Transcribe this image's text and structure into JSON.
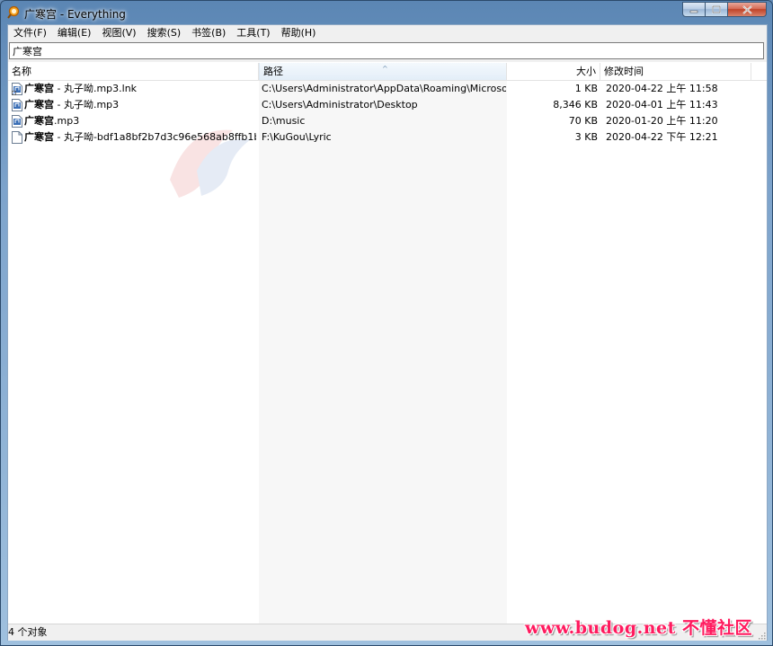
{
  "window": {
    "title": "广寒宫 - Everything",
    "minimize_glyph": "─",
    "maximize_glyph": "□",
    "close_glyph": "✕"
  },
  "menu": [
    "文件(F)",
    "编辑(E)",
    "视图(V)",
    "搜索(S)",
    "书签(B)",
    "工具(T)",
    "帮助(H)"
  ],
  "search": {
    "value": "广寒宫"
  },
  "columns": {
    "name": "名称",
    "path": "路径",
    "size": "大小",
    "modified": "修改时间",
    "sort_arrow": "^"
  },
  "rows": [
    {
      "name_bold": "广寒宫",
      "name_rest": " - 丸子呦.mp3.lnk",
      "path": "C:\\Users\\Administrator\\AppData\\Roaming\\Microsof...",
      "size": "1 KB",
      "modified": "2020-04-22 上午 11:58",
      "icon": "audio-shortcut-icon"
    },
    {
      "name_bold": "广寒宫",
      "name_rest": " - 丸子呦.mp3",
      "path": "C:\\Users\\Administrator\\Desktop",
      "size": "8,346 KB",
      "modified": "2020-04-01 上午 11:43",
      "icon": "audio-file-icon"
    },
    {
      "name_bold": "广寒宫",
      "name_rest": ".mp3",
      "path": "D:\\music",
      "size": "70 KB",
      "modified": "2020-01-20 上午 11:20",
      "icon": "audio-file-icon"
    },
    {
      "name_bold": "广寒宫",
      "name_rest": " - 丸子呦-bdf1a8bf2b7d3c96e568ab8ffb1b...",
      "path": "F:\\KuGou\\Lyric",
      "size": "3 KB",
      "modified": "2020-04-22 下午 12:21",
      "icon": "blank-file-icon"
    }
  ],
  "status": {
    "text": "4 个对象"
  },
  "watermark": {
    "text": "www.budog.net 不懂社区"
  },
  "colors": {
    "accent_watermark": "#ff1a5e",
    "path_column_bg": "#f7f7f7"
  }
}
